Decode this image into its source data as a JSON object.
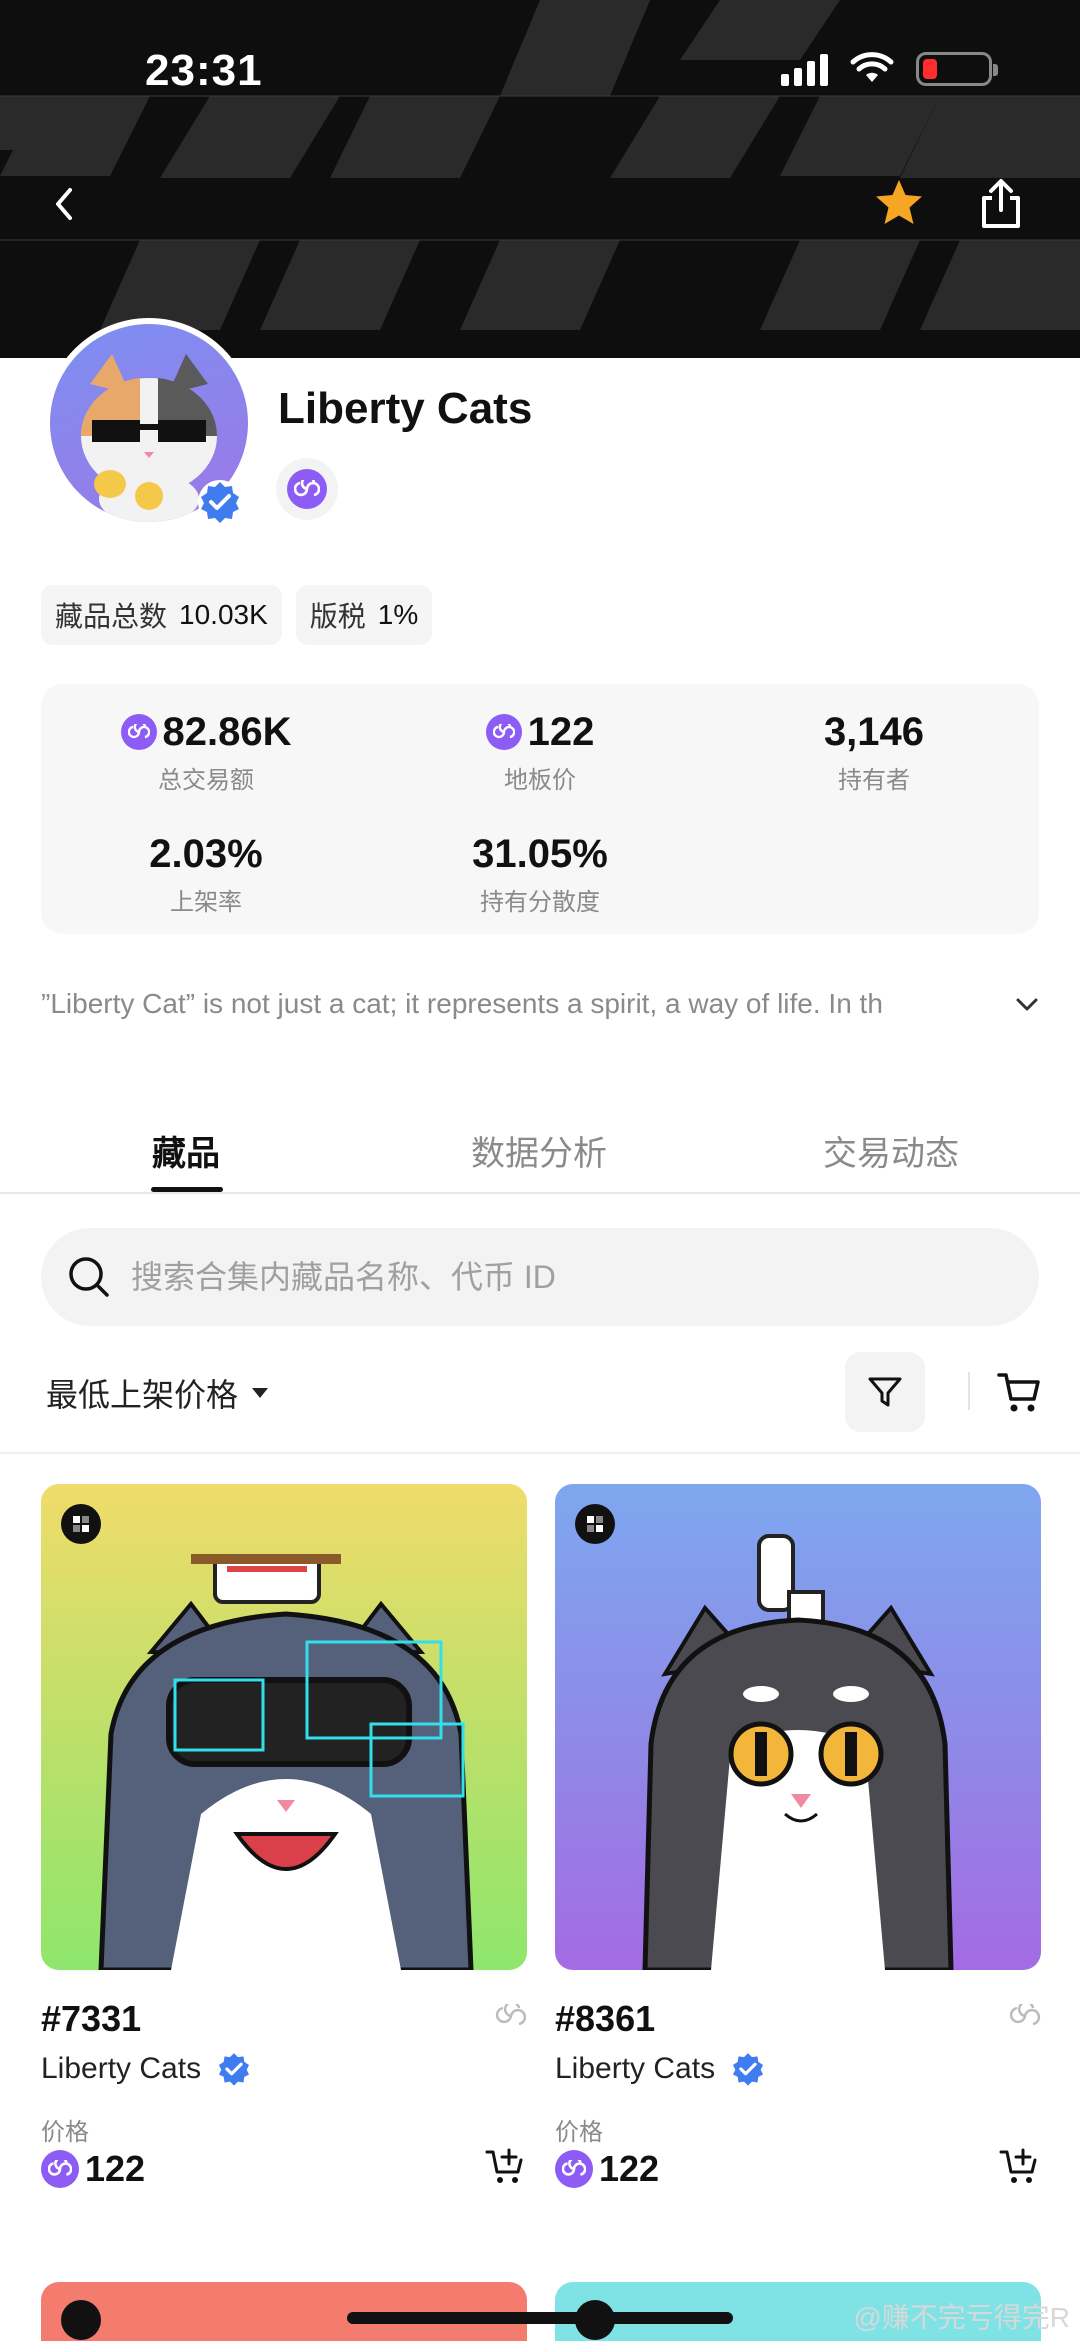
{
  "status_bar": {
    "time": "23:31"
  },
  "collection": {
    "name": "Liberty Cats",
    "chips": [
      {
        "key": "藏品总数",
        "value": "10.03K"
      },
      {
        "key": "版税",
        "value": "1%"
      }
    ],
    "stats": [
      {
        "value": "82.86K",
        "label": "总交易额",
        "has_coin": true
      },
      {
        "value": "122",
        "label": "地板价",
        "has_coin": true
      },
      {
        "value": "3,146",
        "label": "持有者",
        "has_coin": false
      },
      {
        "value": "2.03%",
        "label": "上架率",
        "has_coin": false
      },
      {
        "value": "31.05%",
        "label": "持有分散度",
        "has_coin": false
      }
    ],
    "description": "”Liberty Cat” is not just a cat; it represents a spirit, a way of life. In th"
  },
  "tabs": [
    {
      "label": "藏品",
      "active": true
    },
    {
      "label": "数据分析",
      "active": false
    },
    {
      "label": "交易动态",
      "active": false
    }
  ],
  "search": {
    "placeholder": "搜索合集内藏品名称、代币 ID"
  },
  "sort": {
    "label": "最低上架价格"
  },
  "items": [
    {
      "token": "#7331",
      "collection": "Liberty Cats",
      "price_label": "价格",
      "price": "122"
    },
    {
      "token": "#8361",
      "collection": "Liberty Cats",
      "price_label": "价格",
      "price": "122"
    }
  ],
  "watermark": "@赚不完亏得完R",
  "colors": {
    "accent": "#8c5cf5",
    "verified": "#3f7cf0",
    "star": "#f5a623"
  }
}
